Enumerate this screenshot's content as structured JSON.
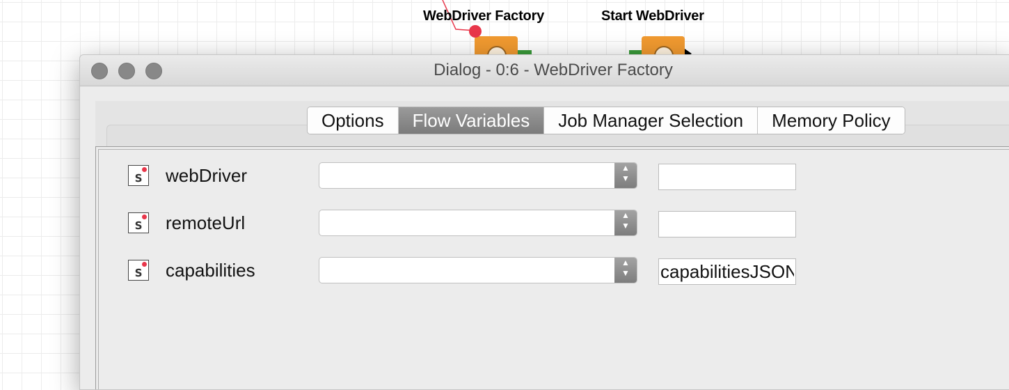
{
  "canvas": {
    "nodes": [
      {
        "label": "WebDriver Factory"
      },
      {
        "label": "Start WebDriver"
      }
    ]
  },
  "dialog": {
    "title": "Dialog - 0:6 - WebDriver Factory",
    "tabs": [
      {
        "label": "Options",
        "active": false
      },
      {
        "label": "Flow Variables",
        "active": true
      },
      {
        "label": "Job Manager Selection",
        "active": false
      },
      {
        "label": "Memory Policy",
        "active": false
      }
    ],
    "flow_variables": [
      {
        "name": "webDriver",
        "type_icon": "s",
        "selected": "",
        "value": ""
      },
      {
        "name": "remoteUrl",
        "type_icon": "s",
        "selected": "",
        "value": ""
      },
      {
        "name": "capabilities",
        "type_icon": "s",
        "selected": "",
        "value": "capabilitiesJSON"
      }
    ]
  },
  "colors": {
    "node_orange": "#f19a30",
    "connection_red": "#e8364a",
    "active_tab": "#8a8a8a"
  }
}
